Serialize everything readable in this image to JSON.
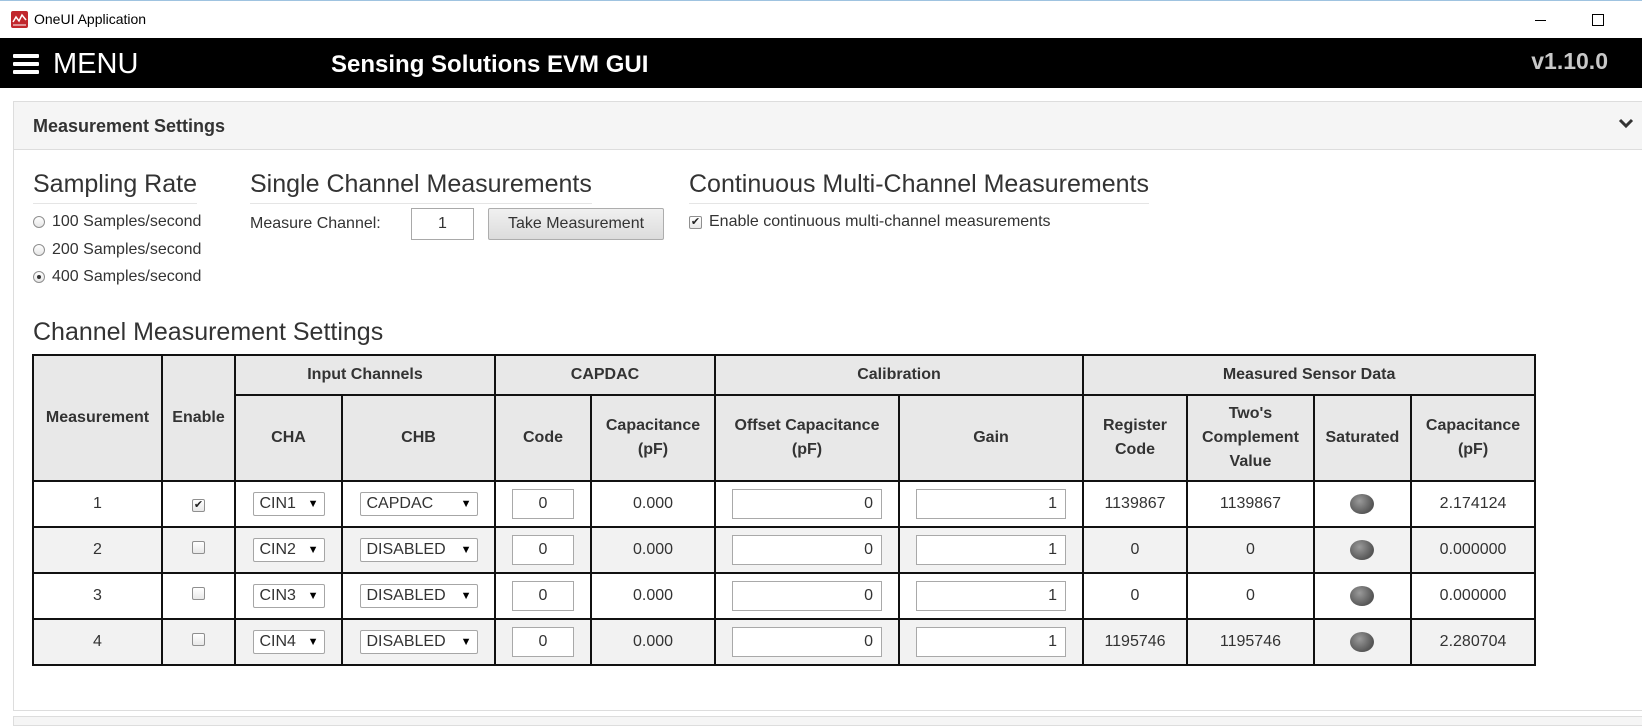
{
  "window": {
    "title": "OneUI Application"
  },
  "header": {
    "menu_label": "MENU",
    "app_name": "Sensing Solutions EVM GUI",
    "version": "v1.10.0"
  },
  "panel": {
    "title": "Measurement Settings"
  },
  "sampling": {
    "title": "Sampling Rate",
    "options": [
      {
        "label": "100 Samples/second",
        "selected": false
      },
      {
        "label": "200 Samples/second",
        "selected": false
      },
      {
        "label": "400 Samples/second",
        "selected": true
      }
    ]
  },
  "single": {
    "title": "Single Channel Measurements",
    "measure_label": "Measure Channel:",
    "channel_value": "1",
    "button_label": "Take Measurement"
  },
  "continuous": {
    "title": "Continuous Multi-Channel Measurements",
    "checkbox_label": "Enable continuous multi-channel measurements",
    "checked": true
  },
  "channel_settings": {
    "title": "Channel Measurement Settings",
    "headers": {
      "measurement": "Measurement",
      "enable": "Enable",
      "input_channels": "Input Channels",
      "capdac": "CAPDAC",
      "calibration": "Calibration",
      "measured": "Measured Sensor Data",
      "cha": "CHA",
      "chb": "CHB",
      "code": "Code",
      "capacitance_pf": "Capacitance (pF)",
      "offset_capacitance": "Offset Capacitance (pF)",
      "gain": "Gain",
      "register_code": "Register Code",
      "twos_complement": "Two's Complement Value",
      "saturated": "Saturated",
      "capacitance_pf_2": "Capacitance (pF)"
    },
    "rows": [
      {
        "measurement": "1",
        "enabled": true,
        "cha": "CIN1",
        "chb": "CAPDAC",
        "code": "0",
        "capacitance": "0.000",
        "offset": "0",
        "gain": "1",
        "register_code": "1139867",
        "twos": "1139867",
        "saturated": false,
        "capacitance_out": "2.174124"
      },
      {
        "measurement": "2",
        "enabled": false,
        "cha": "CIN2",
        "chb": "DISABLED",
        "code": "0",
        "capacitance": "0.000",
        "offset": "0",
        "gain": "1",
        "register_code": "0",
        "twos": "0",
        "saturated": false,
        "capacitance_out": "0.000000"
      },
      {
        "measurement": "3",
        "enabled": false,
        "cha": "CIN3",
        "chb": "DISABLED",
        "code": "0",
        "capacitance": "0.000",
        "offset": "0",
        "gain": "1",
        "register_code": "0",
        "twos": "0",
        "saturated": false,
        "capacitance_out": "0.000000"
      },
      {
        "measurement": "4",
        "enabled": false,
        "cha": "CIN4",
        "chb": "DISABLED",
        "code": "0",
        "capacitance": "0.000",
        "offset": "0",
        "gain": "1",
        "register_code": "1195746",
        "twos": "1195746",
        "saturated": false,
        "capacitance_out": "2.280704"
      }
    ]
  },
  "colors": {
    "header_bg": "#000000",
    "panel_heading_bg": "#f5f5f5",
    "table_header_bg": "#e8e8e8",
    "version_text": "#c8c8c8"
  }
}
